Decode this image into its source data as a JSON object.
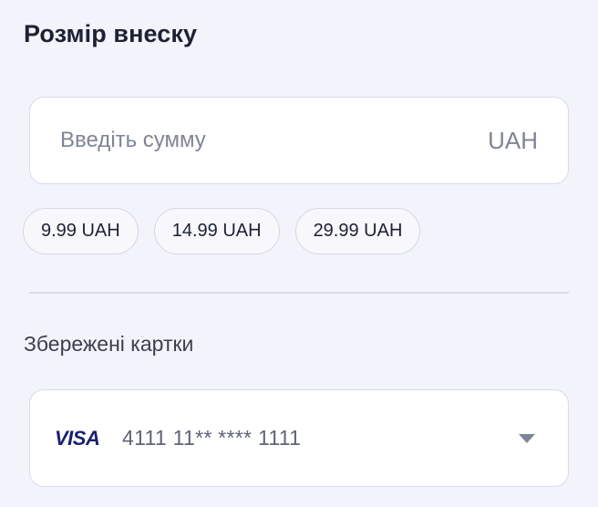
{
  "donation": {
    "title": "Розмір внеску",
    "amount_placeholder": "Введіть сумму",
    "currency": "UAH",
    "presets": [
      "9.99 UAH",
      "14.99 UAH",
      "29.99 UAH"
    ]
  },
  "saved_cards": {
    "title": "Збережені картки",
    "selected": {
      "brand": "VISA",
      "number": "4111 11** **** 1111"
    }
  },
  "colors": {
    "background": "#f3f3fb",
    "visa_brand": "#1a1f71",
    "border": "#d9dbe6"
  },
  "icons": {
    "dropdown": "chevron-down-icon",
    "card_brand": "visa-logo"
  }
}
